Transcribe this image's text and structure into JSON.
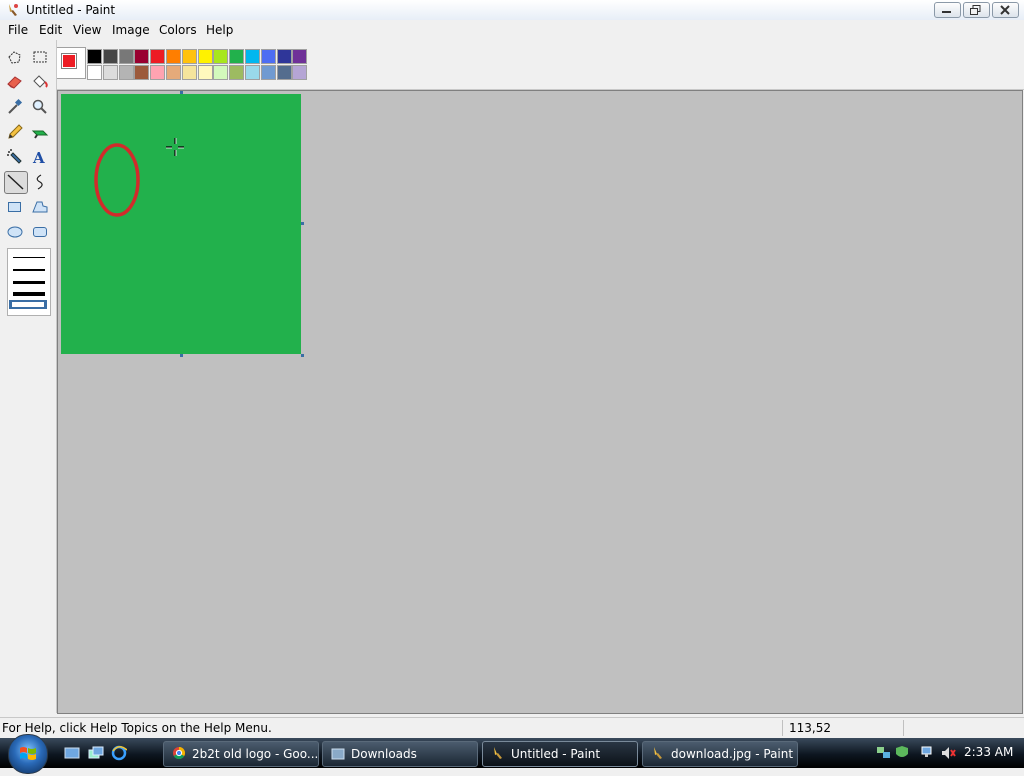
{
  "window": {
    "title": "Untitled - Paint"
  },
  "menu": [
    "File",
    "Edit",
    "View",
    "Image",
    "Colors",
    "Help"
  ],
  "colors": {
    "foreground": "#ed1c24",
    "background": "#ffffff",
    "palette_top": [
      "#000000",
      "#464646",
      "#787878",
      "#990030",
      "#ed1c24",
      "#ff7e00",
      "#ffc20e",
      "#fff200",
      "#a8e61d",
      "#22b14c",
      "#00b7ef",
      "#4d6df3",
      "#2f3699",
      "#6f3198"
    ],
    "palette_bottom": [
      "#ffffff",
      "#dcdcdc",
      "#b4b4b4",
      "#9c5a3c",
      "#ffa3b1",
      "#e5aa7a",
      "#f5e49c",
      "#fff9bd",
      "#d3f9bc",
      "#9dbb61",
      "#99d9ea",
      "#709ad1",
      "#546d8e",
      "#b5a5d5"
    ]
  },
  "tools": [
    {
      "name": "free-form-select",
      "icon": "free-form-select-icon"
    },
    {
      "name": "select",
      "icon": "rect-select-icon"
    },
    {
      "name": "eraser",
      "icon": "eraser-icon"
    },
    {
      "name": "fill",
      "icon": "fill-bucket-icon"
    },
    {
      "name": "pick-color",
      "icon": "eyedropper-icon"
    },
    {
      "name": "magnifier",
      "icon": "magnifier-icon"
    },
    {
      "name": "pencil",
      "icon": "pencil-icon"
    },
    {
      "name": "brush",
      "icon": "brush-icon"
    },
    {
      "name": "airbrush",
      "icon": "airbrush-icon"
    },
    {
      "name": "text",
      "icon": "text-icon"
    },
    {
      "name": "line",
      "icon": "line-icon",
      "selected": true
    },
    {
      "name": "curve",
      "icon": "curve-icon"
    },
    {
      "name": "rectangle",
      "icon": "rectangle-icon"
    },
    {
      "name": "polygon",
      "icon": "polygon-icon"
    },
    {
      "name": "ellipse",
      "icon": "ellipse-icon"
    },
    {
      "name": "rounded-rectangle",
      "icon": "rounded-rectangle-icon"
    }
  ],
  "canvas": {
    "fill": "#22b14c",
    "shape_color": "#d22b2b"
  },
  "status": {
    "help_text": "For Help, click Help Topics on the Help Menu.",
    "coords": "113,52"
  },
  "taskbar": {
    "tasks": [
      {
        "label": "2b2t old logo - Goo...",
        "icon": "chrome-icon",
        "active": false
      },
      {
        "label": "Downloads",
        "icon": "folder-icon",
        "active": false
      },
      {
        "label": "Untitled - Paint",
        "icon": "paint-icon",
        "active": true
      },
      {
        "label": "download.jpg - Paint",
        "icon": "paint-icon",
        "active": false
      }
    ],
    "clock": "2:33 AM"
  }
}
